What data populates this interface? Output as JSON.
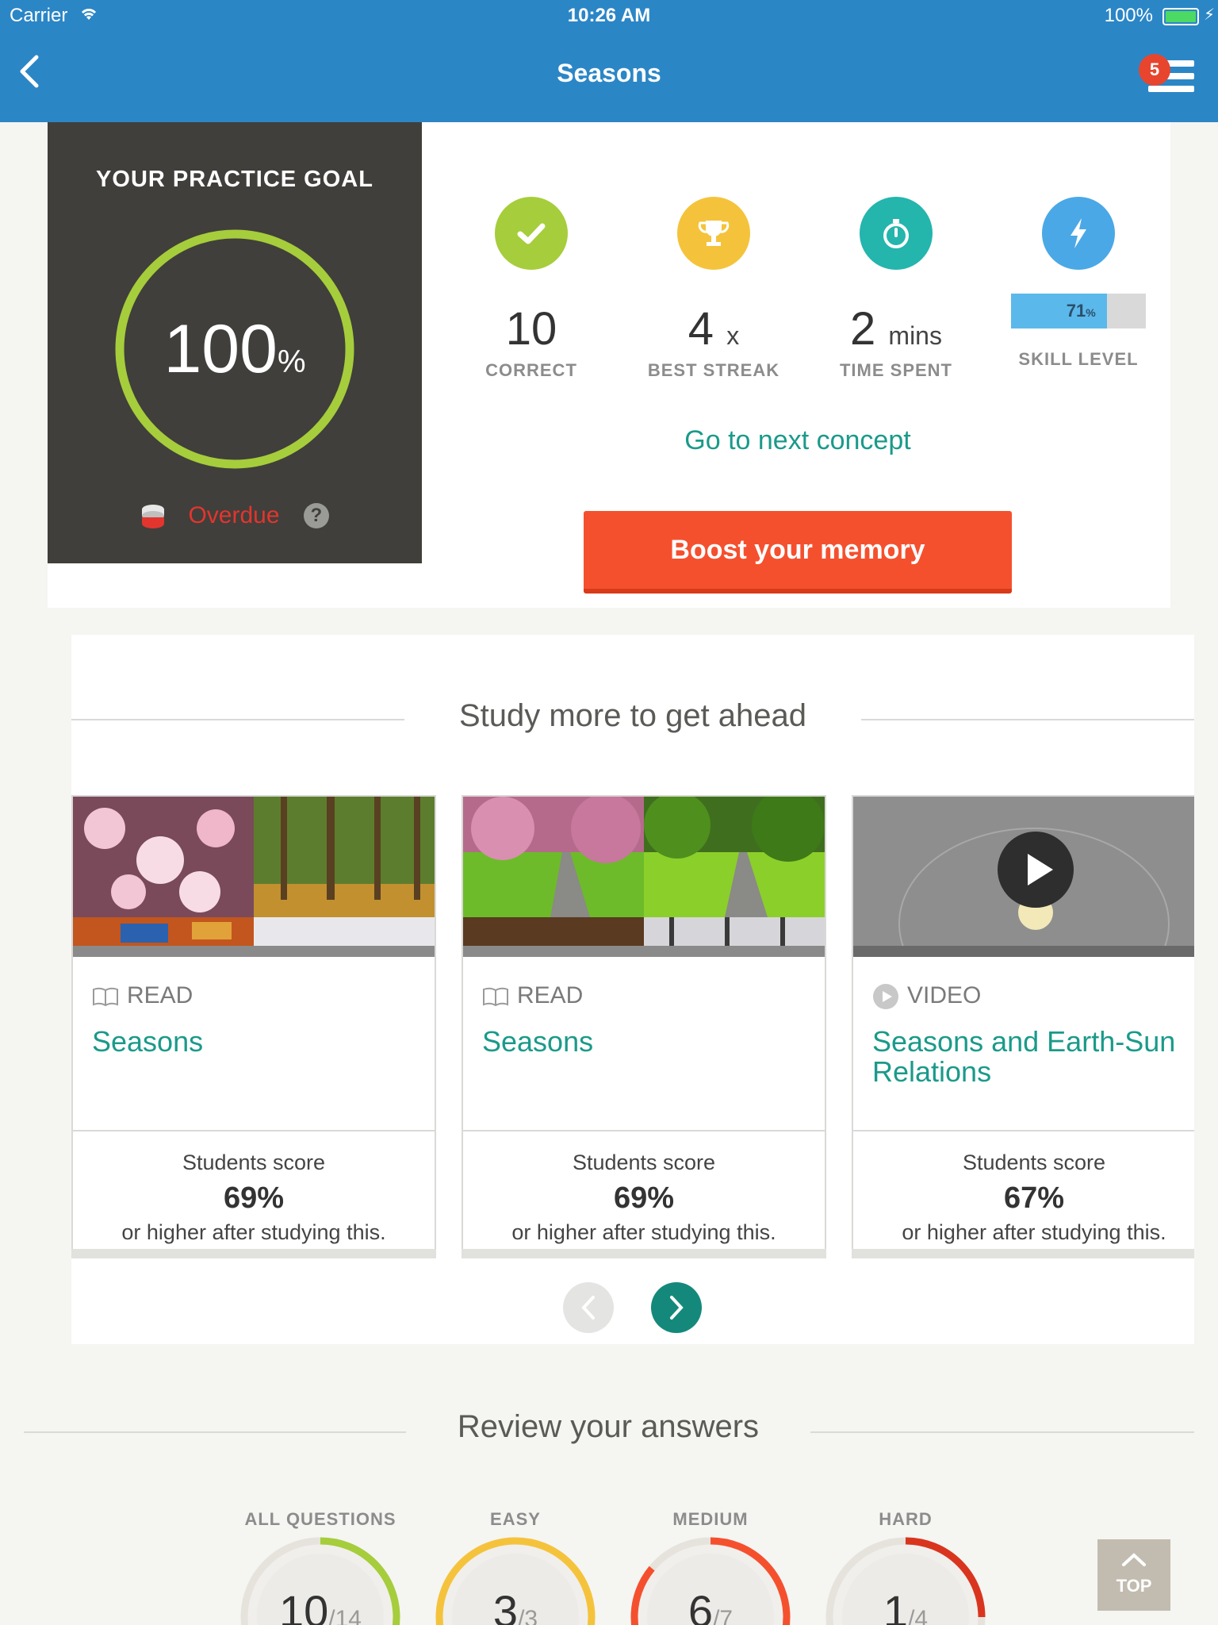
{
  "status_bar": {
    "carrier": "Carrier",
    "time": "10:26 AM",
    "battery": "100%"
  },
  "nav": {
    "title": "Seasons",
    "notifications": "5"
  },
  "practice_goal": {
    "title": "YOUR PRACTICE GOAL",
    "percent": "100",
    "percent_unit": "%",
    "status": "Overdue",
    "help": "?"
  },
  "stats": {
    "correct": {
      "value": "10",
      "unit": "",
      "caption": "CORRECT"
    },
    "streak": {
      "value": "4",
      "unit": "x",
      "caption": "BEST STREAK"
    },
    "time": {
      "value": "2",
      "unit": "mins",
      "caption": "TIME SPENT"
    },
    "skill": {
      "value": "71",
      "unit": "%",
      "caption": "SKILL LEVEL",
      "fraction": 0.71
    }
  },
  "next_concept": "Go to next concept",
  "boost_button": "Boost your memory",
  "study_more": {
    "title": "Study more to get ahead",
    "cards": [
      {
        "kind": "READ",
        "title": "Seasons",
        "line1": "Students score",
        "score": "69%",
        "line2": "or higher after studying this."
      },
      {
        "kind": "READ",
        "title": "Seasons",
        "line1": "Students score",
        "score": "69%",
        "line2": "or higher after studying this."
      },
      {
        "kind": "VIDEO",
        "title": "Seasons and Earth-Sun Relations",
        "line1": "Students score",
        "score": "67%",
        "line2": "or higher after studying this."
      }
    ]
  },
  "review": {
    "title": "Review your answers",
    "groups": [
      {
        "label": "ALL QUESTIONS",
        "correct": "10",
        "total": "/14",
        "fraction": 0.71,
        "color": "#a6cd3b"
      },
      {
        "label": "EASY",
        "correct": "3",
        "total": "/3",
        "fraction": 1.0,
        "color": "#f5c33b"
      },
      {
        "label": "MEDIUM",
        "correct": "6",
        "total": "/7",
        "fraction": 0.86,
        "color": "#f5502e"
      },
      {
        "label": "HARD",
        "correct": "1",
        "total": "/4",
        "fraction": 0.25,
        "color": "#d9351e"
      }
    ]
  },
  "top_button": "TOP",
  "colors": {
    "header": "#2b86c6",
    "accent_teal": "#1a9a8a",
    "boost": "#f5502e",
    "goal_ring": "#a6cd3b"
  }
}
